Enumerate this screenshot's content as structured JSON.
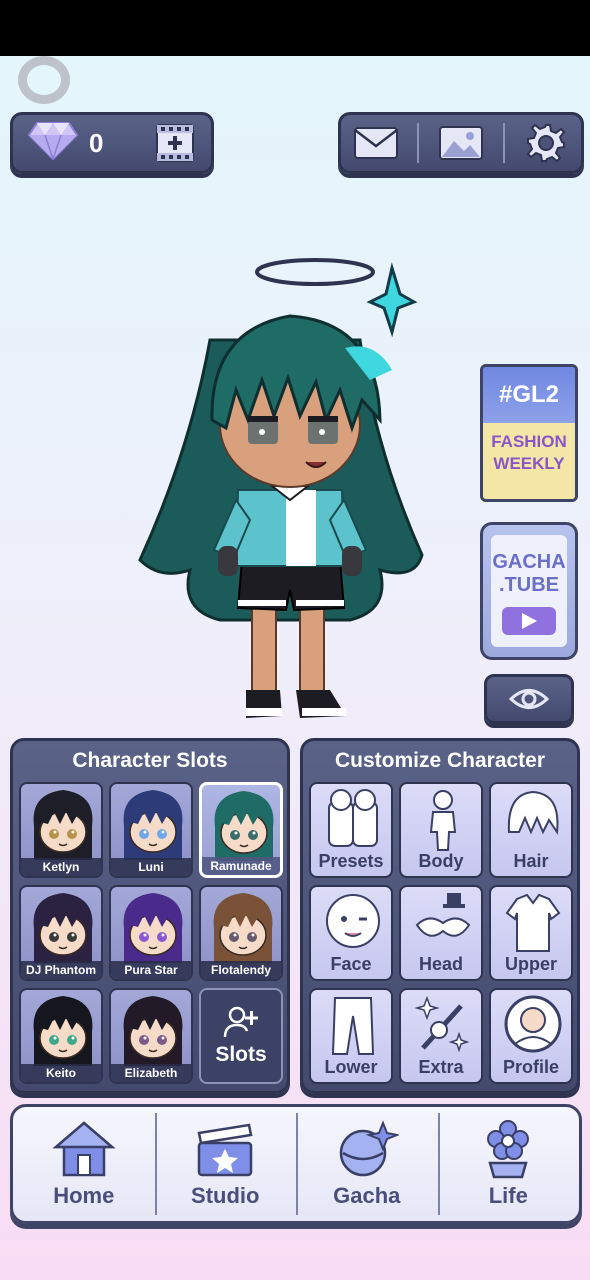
{
  "top_bar": {
    "gem_icon": "diamond-icon",
    "gem_count": "0",
    "add_film_icon": "film-plus-icon",
    "actions": [
      {
        "name": "mail-icon"
      },
      {
        "name": "image-icon"
      },
      {
        "name": "gear-icon"
      }
    ]
  },
  "side": {
    "gl2": {
      "tag": "#GL2",
      "line1": "FASHION",
      "line2": "WEEKLY"
    },
    "tube": {
      "line1": "GACHA",
      "line2": ".TUBE",
      "icon": "play-icon"
    },
    "eye_icon": "eye-icon"
  },
  "character_slots": {
    "title": "Character Slots",
    "slots": [
      {
        "name": "Ketlyn",
        "hair": "#1e1e28",
        "eyes": "#b8914a",
        "selected": false
      },
      {
        "name": "Luni",
        "hair": "#2d3c78",
        "eyes": "#6ea6e8",
        "selected": false
      },
      {
        "name": "Ramunade",
        "hair": "#1f6b66",
        "eyes": "#3b6e6a",
        "selected": true
      },
      {
        "name": "DJ Phantom",
        "hair": "#2a2240",
        "eyes": "#3a3a3a",
        "selected": false
      },
      {
        "name": "Pura Star",
        "hair": "#4a2a8a",
        "eyes": "#8a58d0",
        "selected": false
      },
      {
        "name": "Flotalendy",
        "hair": "#7a5238",
        "eyes": "#6a5a70",
        "selected": false
      },
      {
        "name": "Keito",
        "hair": "#16161e",
        "eyes": "#3fa88a",
        "selected": false
      },
      {
        "name": "Elizabeth",
        "hair": "#221a26",
        "eyes": "#7a5a8a",
        "selected": false
      }
    ],
    "add_button": {
      "label": "Slots",
      "icon": "add-user-icon"
    }
  },
  "customize": {
    "title": "Customize Character",
    "items": [
      {
        "label": "Presets",
        "icon": "presets-icon"
      },
      {
        "label": "Body",
        "icon": "body-icon"
      },
      {
        "label": "Hair",
        "icon": "hair-icon"
      },
      {
        "label": "Face",
        "icon": "face-icon"
      },
      {
        "label": "Head",
        "icon": "head-accessory-icon"
      },
      {
        "label": "Upper",
        "icon": "shirt-icon"
      },
      {
        "label": "Lower",
        "icon": "pants-icon"
      },
      {
        "label": "Extra",
        "icon": "sparkle-wand-icon"
      },
      {
        "label": "Profile",
        "icon": "profile-icon"
      }
    ]
  },
  "bottom_nav": [
    {
      "label": "Home",
      "icon": "house-icon"
    },
    {
      "label": "Studio",
      "icon": "clapperboard-icon"
    },
    {
      "label": "Gacha",
      "icon": "gacha-orb-icon"
    },
    {
      "label": "Life",
      "icon": "flower-icon"
    }
  ],
  "colors": {
    "panel": "#4b5278",
    "panel_border": "#2e3350",
    "accent_purple": "#8f72e0",
    "character_hair": "#1b5c5a",
    "character_shirt": "#5cc3cc"
  }
}
